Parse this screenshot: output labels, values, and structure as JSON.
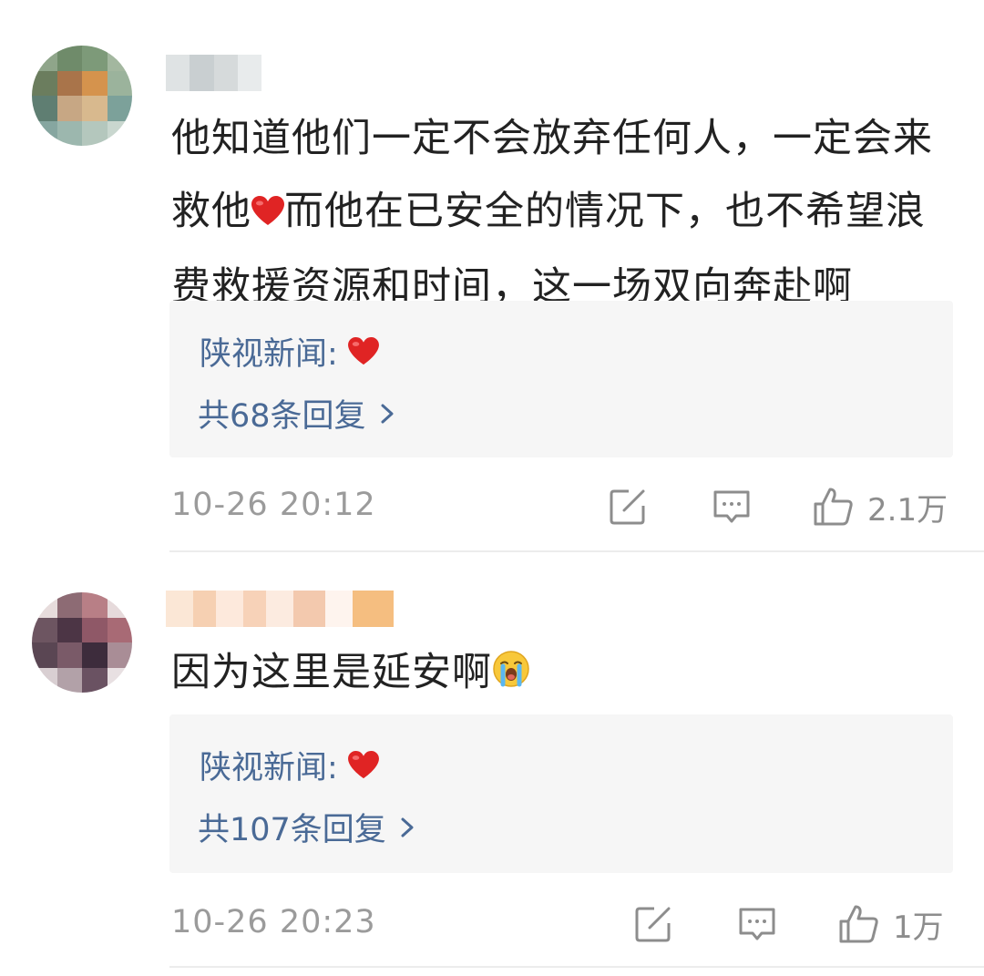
{
  "comments": [
    {
      "text": "他知道他们一定不会放弃任何人，一定会来救他",
      "text_after_emoji": "而他在已安全的情况下，也不希望浪费救援资源和时间，这一场双向奔赴啊",
      "emoji": "heart-emoji",
      "reply": {
        "author": "陕视新闻:",
        "author_emoji": "heart-emoji",
        "count_label": "共68条回复"
      },
      "timestamp": "10-26 20:12",
      "likes": "2.1万"
    },
    {
      "text": "因为这里是延安啊",
      "emoji": "crying-face-emoji",
      "reply": {
        "author": "陕视新闻:",
        "author_emoji": "heart-emoji",
        "count_label": "共107条回复"
      },
      "timestamp": "10-26 20:23",
      "likes": "1万"
    }
  ],
  "icons": {
    "share": "share-edit-icon",
    "comment": "comment-icon",
    "like": "thumbs-up-icon",
    "reply_arrow": "chevron-right-icon"
  },
  "colors": {
    "reply_text": "#4a6a96",
    "reply_bg": "#f6f6f6",
    "meta_text": "#9b9b9b",
    "heart": "#e02424"
  }
}
